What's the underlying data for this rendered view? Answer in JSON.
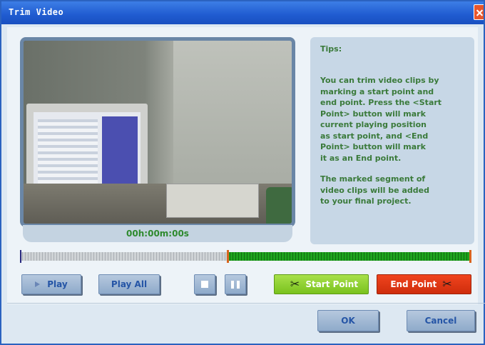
{
  "window": {
    "title": "Trim Video"
  },
  "player": {
    "timecode": "00h:00m:00s"
  },
  "tips": {
    "title": "Tips:",
    "paragraph1": "You can trim video clips by\nmarking a start point and\nend point. Press the <Start\nPoint> button will mark\ncurrent playing position\nas start point, and <End\nPoint> button will mark\nit as an End point.",
    "paragraph2": "The marked segment of\nvideo clips will be added\nto your final project."
  },
  "timeline": {
    "marked_start_fraction": 0.46,
    "marked_end_fraction": 1.0
  },
  "controls": {
    "play_label": "Play",
    "play_all_label": "Play All",
    "start_point_label": "Start Point",
    "end_point_label": "End Point"
  },
  "dialog_buttons": {
    "ok_label": "OK",
    "cancel_label": "Cancel"
  },
  "icons": {
    "close": "close-icon",
    "play": "play-icon",
    "stop": "stop-icon",
    "pause": "pause-icon",
    "scissors": "scissors-icon"
  },
  "colors": {
    "titlebar": "#1f5bd0",
    "start_point": "#7ac21e",
    "end_point": "#cf2d0c",
    "marked_segment": "#1ea31e",
    "tips_text": "#3a7a3a"
  }
}
